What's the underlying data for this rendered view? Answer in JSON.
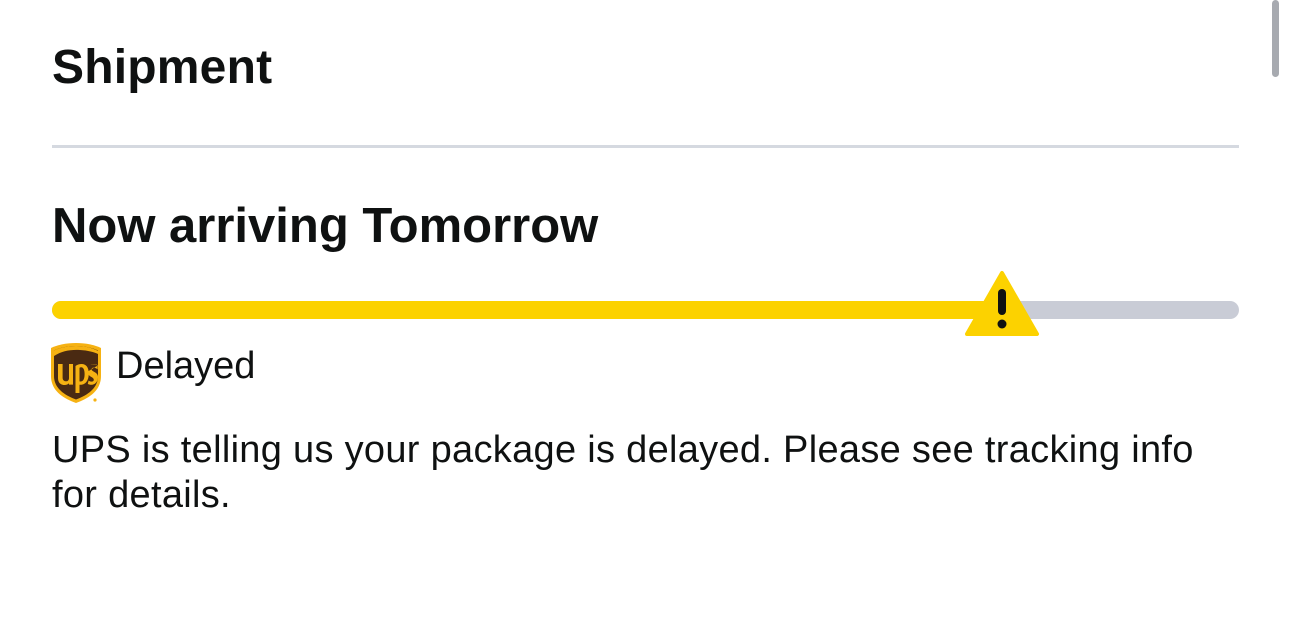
{
  "shipment": {
    "section_title": "Shipment",
    "arrival_text": "Now arriving Tomorrow",
    "progress": {
      "fraction": 0.8,
      "fill_color": "#FCD200",
      "track_color": "#C9CCD6",
      "marker_icon": "warning-triangle-icon",
      "marker_color": "#FCD200"
    },
    "carrier": {
      "logo": "ups",
      "logo_icon": "ups-shield-logo"
    },
    "status_text": "Delayed",
    "message": "UPS is telling us your package is delayed. Please see tracking info for details."
  }
}
